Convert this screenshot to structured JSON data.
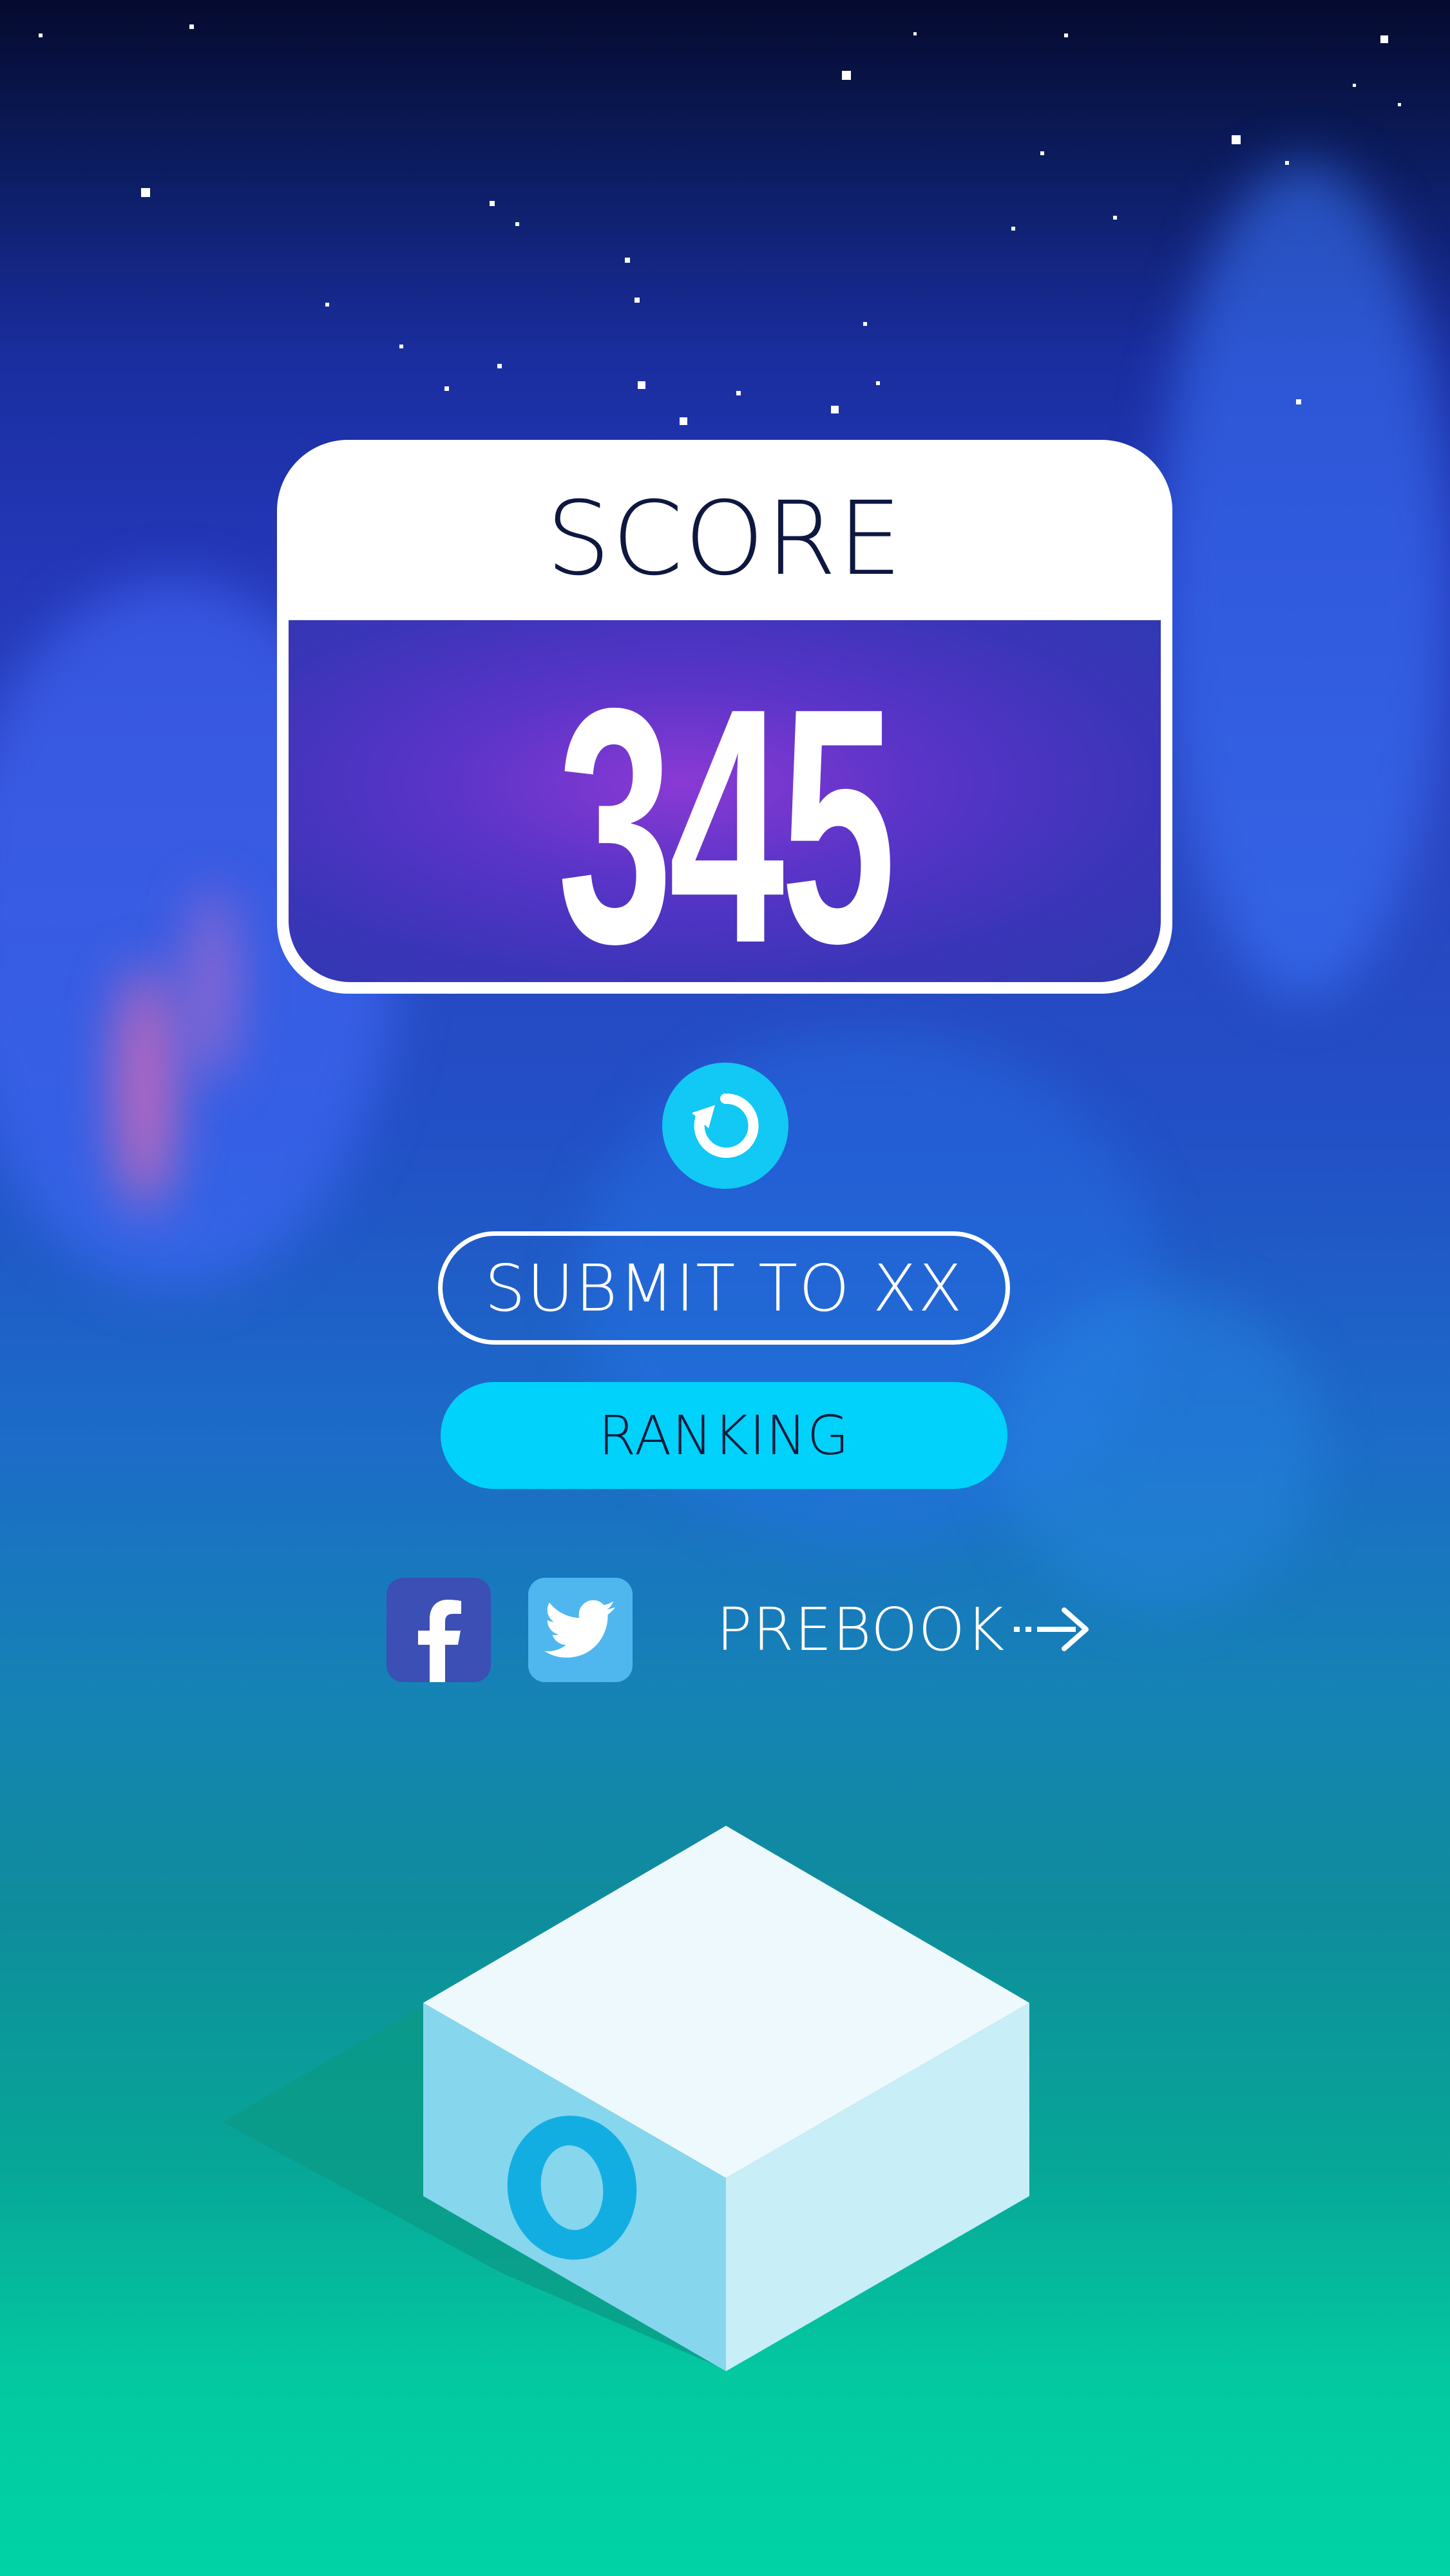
{
  "score_card": {
    "title": "SCORE",
    "value": "345"
  },
  "actions": {
    "restart_icon": "restart-icon",
    "submit_label": "SUBMIT TO XX",
    "ranking_label": "RANKING"
  },
  "social": {
    "facebook_icon": "facebook-icon",
    "twitter_icon": "twitter-icon",
    "prebook_label": "PREBOOK",
    "prebook_icon": "dashed-arrow-right-icon"
  },
  "colors": {
    "accent_cyan": "#00d2fb",
    "restart_blue": "#12c8f4",
    "facebook_blue": "#3b4fb4",
    "twitter_blue": "#4fb7ee",
    "score_title": "#0d1740",
    "cube_top": "#eef9fd",
    "cube_right": "#c8eef8",
    "cube_left": "#86d6ee",
    "cube_ring": "#12aee2"
  }
}
